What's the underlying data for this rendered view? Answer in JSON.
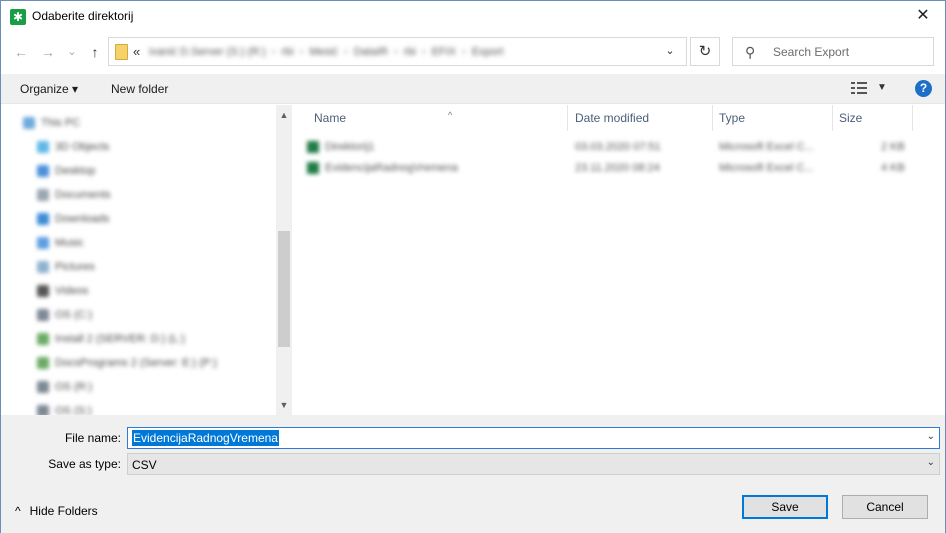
{
  "window": {
    "title": "Odaberite direktorij",
    "app_icon_glyph": "✱",
    "close_glyph": "✕"
  },
  "nav": {
    "back_glyph": "←",
    "forward_glyph": "→",
    "recent_glyph": "⌄",
    "up_glyph": "↑",
    "address_prefix": "«",
    "breadcrumbs": [
      "ivanić D.Server (S:) (R:)",
      "rbi",
      "Mesić",
      "DataIR",
      "rbi",
      "EFIX",
      "Export"
    ],
    "crumb_sep": "›",
    "address_dropdown_glyph": "⌄",
    "refresh_glyph": "↻",
    "search_placeholder": "Search Export",
    "search_glyph": "⚲"
  },
  "toolbar": {
    "organize_label": "Organize ▾",
    "new_folder_label": "New folder",
    "view_dropdown_glyph": "▼",
    "help_glyph": "?"
  },
  "sidebar": {
    "scroll_up_glyph": "▲",
    "scroll_down_glyph": "▼",
    "items": [
      {
        "label": "This PC",
        "color": "#6fa8dc"
      },
      {
        "label": "3D Objects",
        "color": "#5fb7e5"
      },
      {
        "label": "Desktop",
        "color": "#4a90d9"
      },
      {
        "label": "Documents",
        "color": "#9aa5b1"
      },
      {
        "label": "Downloads",
        "color": "#3d8bd8"
      },
      {
        "label": "Music",
        "color": "#5c9ee0"
      },
      {
        "label": "Pictures",
        "color": "#8fb1d0"
      },
      {
        "label": "Videos",
        "color": "#555555"
      },
      {
        "label": "OS (C:)",
        "color": "#7d8894"
      },
      {
        "label": "Install 2 (SERVER: D:) (L:)",
        "color": "#6aaa64"
      },
      {
        "label": "DocsPrograms 2 (Server: E:) (P:)",
        "color": "#6aaa64"
      },
      {
        "label": "OS (R:)",
        "color": "#7d8894"
      },
      {
        "label": "OS (S:)",
        "color": "#7d8894"
      }
    ]
  },
  "filelist": {
    "columns": [
      "Name",
      "Date modified",
      "Type",
      "Size"
    ],
    "sort_glyph": "^",
    "rows": [
      {
        "name": "Direktorij1",
        "date": "03.03.2020 07:51",
        "type": "Microsoft Excel C...",
        "size": "2 KB"
      },
      {
        "name": "EvidencijaRadnogVremena",
        "date": "23.11.2020 08:24",
        "type": "Microsoft Excel C...",
        "size": "4 KB"
      }
    ]
  },
  "bottom": {
    "file_name_label": "File name:",
    "file_name_value": "EvidencijaRadnogVremena",
    "save_type_label": "Save as type:",
    "save_type_value": "CSV",
    "dropdown_glyph": "⌄",
    "hide_folders_glyph": "^",
    "hide_folders_label": "Hide Folders",
    "save_label": "Save",
    "cancel_label": "Cancel"
  }
}
